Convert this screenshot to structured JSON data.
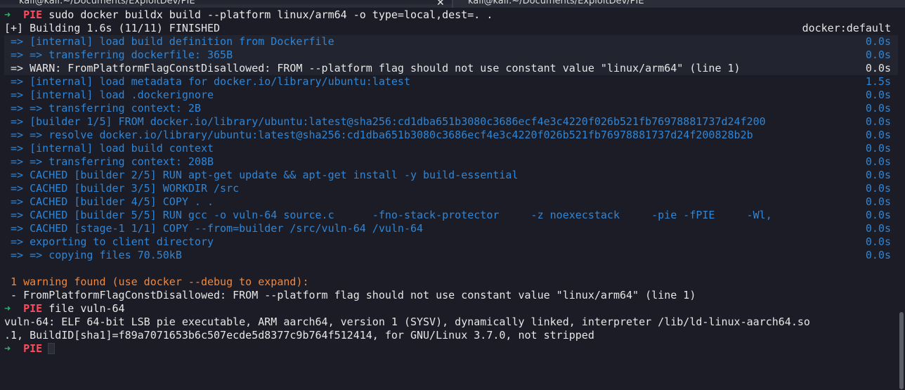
{
  "tabs": [
    {
      "title": "kali@kali:~/Documents/ExploitDev/PIE",
      "close": "✕"
    },
    {
      "title": "kali@kali:~/Documents/ExploitDev/PIE"
    }
  ],
  "prompt": {
    "arrow": "➜",
    "dir": "PIE"
  },
  "commands": {
    "build": "sudo docker buildx build --platform linux/arm64 -o type=local,dest=. .",
    "file": "file vuln-64"
  },
  "build_header": {
    "text": "[+] Building 1.6s (11/11) FINISHED",
    "tag": "docker:default"
  },
  "build_steps": [
    {
      "text": "=> [internal] load build definition from Dockerfile",
      "time": "0.0s",
      "style": "blue"
    },
    {
      "text": "=> => transferring dockerfile: 365B",
      "time": "0.0s",
      "style": "blue"
    },
    {
      "text": "=> WARN: FromPlatformFlagConstDisallowed: FROM --platform flag should not use constant value \"linux/arm64\" (line 1)",
      "time": "0.0s",
      "style": "white"
    },
    {
      "text": "=> [internal] load metadata for docker.io/library/ubuntu:latest",
      "time": "1.5s",
      "style": "blue"
    },
    {
      "text": "=> [internal] load .dockerignore",
      "time": "0.0s",
      "style": "blue"
    },
    {
      "text": "=> => transferring context: 2B",
      "time": "0.0s",
      "style": "blue"
    },
    {
      "text": "=> [builder 1/5] FROM docker.io/library/ubuntu:latest@sha256:cd1dba651b3080c3686ecf4e3c4220f026b521fb76978881737d24f200",
      "time": "0.0s",
      "style": "blue"
    },
    {
      "text": "=> => resolve docker.io/library/ubuntu:latest@sha256:cd1dba651b3080c3686ecf4e3c4220f026b521fb76978881737d24f200828b2b",
      "time": "0.0s",
      "style": "blue"
    },
    {
      "text": "=> [internal] load build context",
      "time": "0.0s",
      "style": "blue"
    },
    {
      "text": "=> => transferring context: 208B",
      "time": "0.0s",
      "style": "blue"
    },
    {
      "text": "=> CACHED [builder 2/5] RUN apt-get update && apt-get install -y build-essential",
      "time": "0.0s",
      "style": "blue"
    },
    {
      "text": "=> CACHED [builder 3/5] WORKDIR /src",
      "time": "0.0s",
      "style": "blue"
    },
    {
      "text": "=> CACHED [builder 4/5] COPY . .",
      "time": "0.0s",
      "style": "blue"
    },
    {
      "text": "=> CACHED [builder 5/5] RUN gcc -o vuln-64 source.c      -fno-stack-protector     -z noexecstack     -pie -fPIE     -Wl,",
      "time": "0.0s",
      "style": "blue"
    },
    {
      "text": "=> CACHED [stage-1 1/1] COPY --from=builder /src/vuln-64 /vuln-64",
      "time": "0.0s",
      "style": "blue"
    },
    {
      "text": "=> exporting to client directory",
      "time": "0.0s",
      "style": "blue"
    },
    {
      "text": "=> => copying files 70.50kB",
      "time": "0.0s",
      "style": "blue"
    }
  ],
  "warning": {
    "summary": " 1 warning found (use docker --debug to expand):",
    "detail": " - FromPlatformFlagConstDisallowed: FROM --platform flag should not use constant value \"linux/arm64\" (line 1)"
  },
  "file_output": {
    "line1": "vuln-64: ELF 64-bit LSB pie executable, ARM aarch64, version 1 (SYSV), dynamically linked, interpreter /lib/ld-linux-aarch64.so",
    "line2": ".1, BuildID[sha1]=f89a7071653b6c507ecde5d8377c9b764f512414, for GNU/Linux 3.7.0, not stripped"
  },
  "colors": {
    "background": "#1b1c26",
    "prompt_arrow": "#29b36b",
    "prompt_dir": "#ff4b5c",
    "step_blue": "#2f86d6",
    "warning_orange": "#f0883e"
  }
}
